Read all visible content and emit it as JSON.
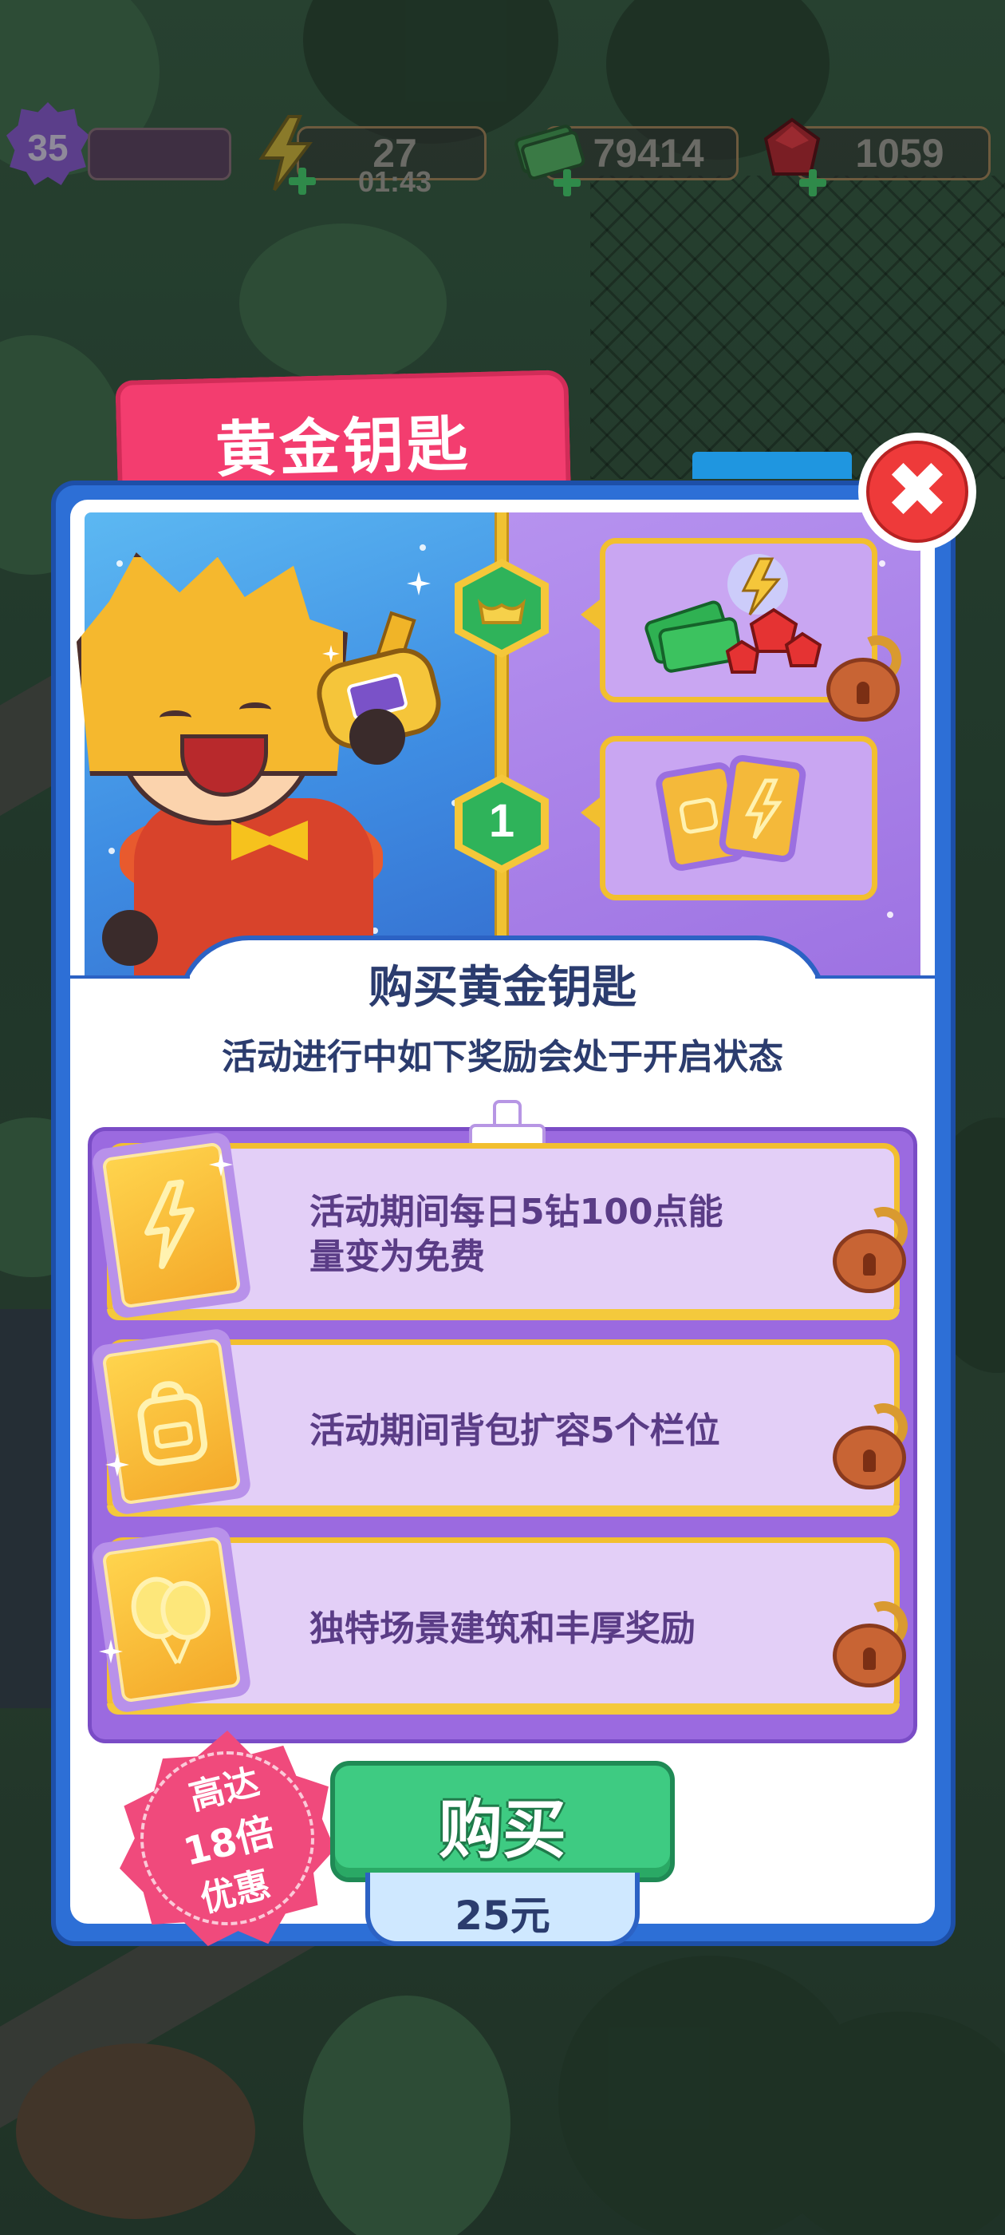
{
  "hud": {
    "level": "35",
    "xp_fraction": 0.0,
    "energy": "27",
    "energy_timer": "01:43",
    "cash": "79414",
    "gems": "1059"
  },
  "popup": {
    "title": "黄金钥匙",
    "close_icon": "close-x-icon",
    "track": {
      "tier_free_icon": "gold-ingot-icon",
      "tier_1_label": "1"
    },
    "rewards": [
      {
        "icon": "cash-and-gems-icon",
        "locked": true
      },
      {
        "icon": "energy-and-backpack-cards-icon",
        "locked": true
      }
    ],
    "heading": "购买黄金钥匙",
    "subheading": "活动进行中如下奖励会处于开启状态",
    "benefits": [
      {
        "icon": "lightning-card-icon",
        "text_line1": "活动期间每日5钻100点能",
        "text_line2": "量变为免费",
        "locked": true
      },
      {
        "icon": "backpack-card-icon",
        "text_line1": "活动期间背包扩容5个栏位",
        "text_line2": "",
        "locked": true
      },
      {
        "icon": "balloon-card-icon",
        "text_line1": "独特场景建筑和丰厚奖励",
        "text_line2": "",
        "locked": true
      }
    ],
    "promo_badge": {
      "line1": "高达",
      "line2": "18倍",
      "line3": "优惠"
    },
    "buy_label": "购买",
    "price": "25元"
  },
  "colors": {
    "title_tab": "#f33d6f",
    "panel_border": "#2d6fd6",
    "buy_button": "#3ecb82",
    "list_purple": "#9b6ae0",
    "gold": "#f2bf2f"
  }
}
